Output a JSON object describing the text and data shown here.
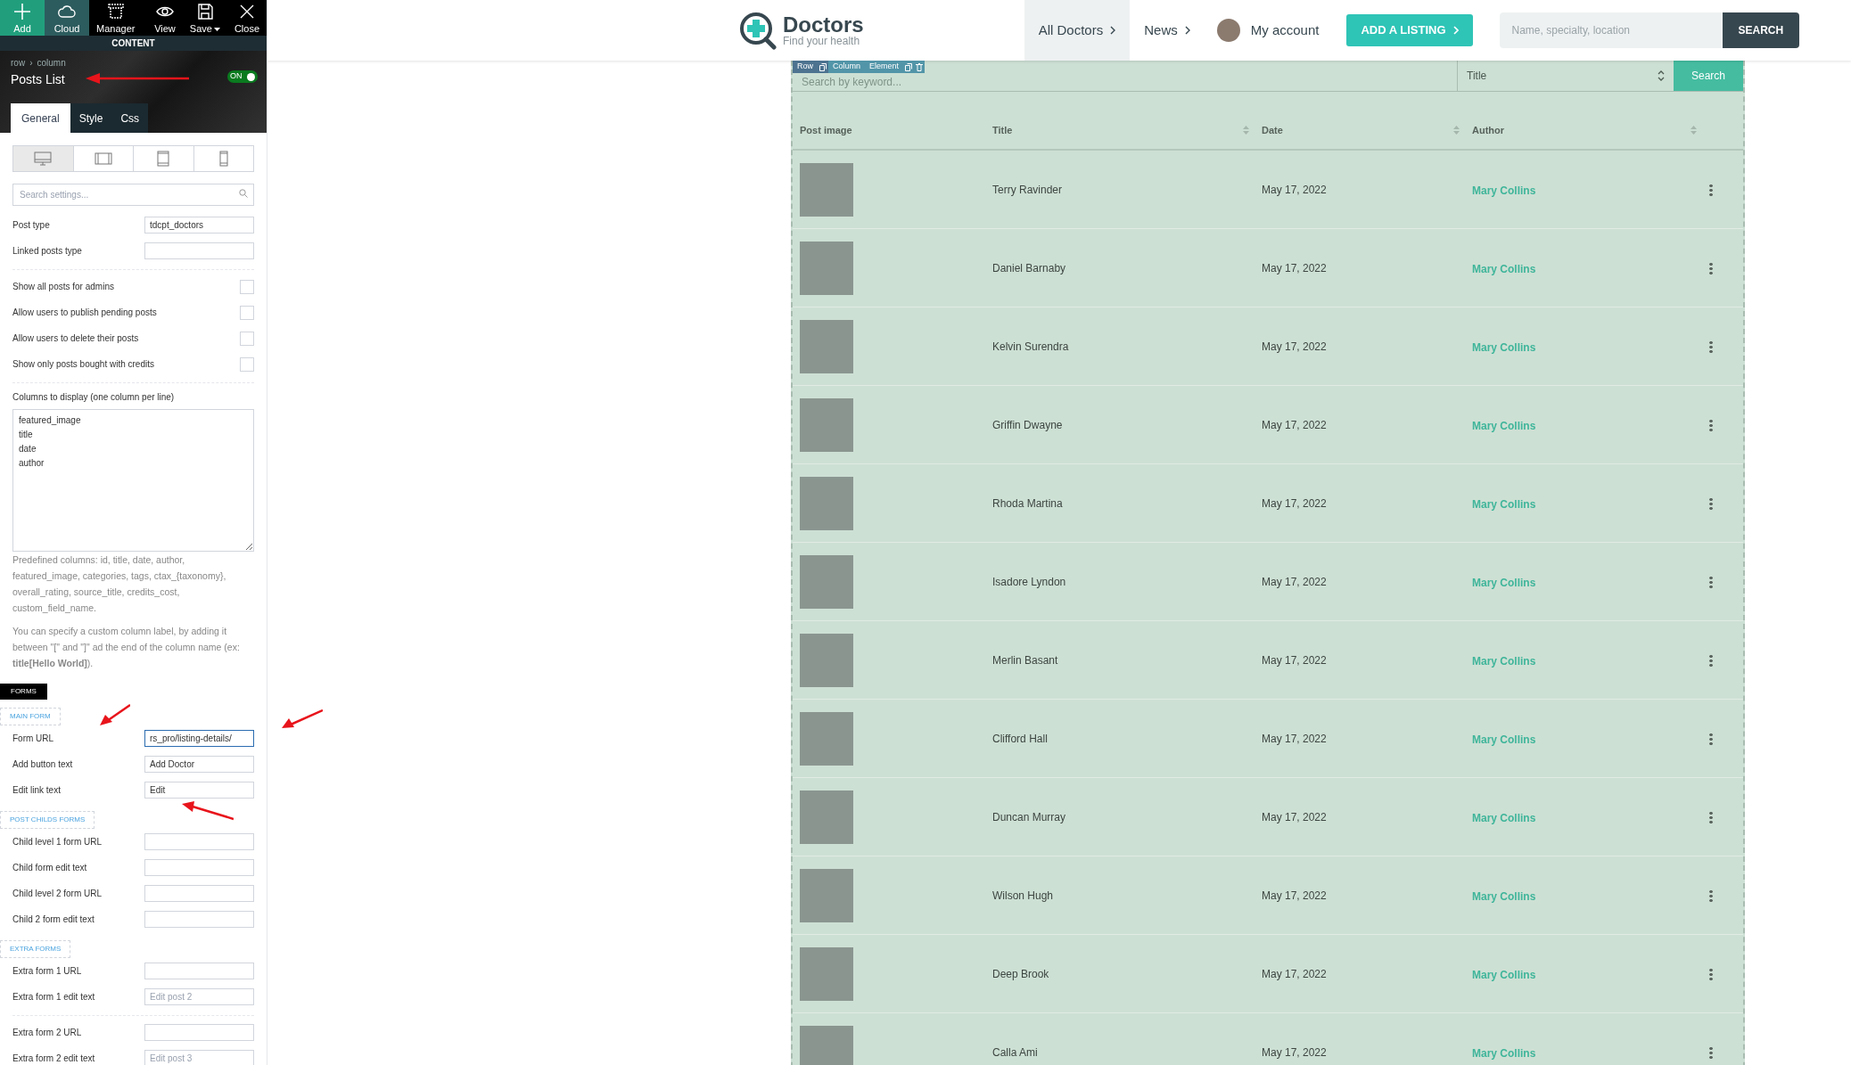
{
  "toolbar": {
    "buttons": [
      {
        "label": "Add",
        "kind": "add"
      },
      {
        "label": "Cloud",
        "kind": "cloud"
      },
      {
        "label": "Manager",
        "kind": "manager"
      },
      {
        "label": "View",
        "kind": "view"
      },
      {
        "label": "Save",
        "kind": "save"
      },
      {
        "label": "Close",
        "kind": "close"
      }
    ],
    "section": "CONTENT"
  },
  "element_panel": {
    "breadcrumb": [
      "row",
      "column"
    ],
    "breadcrumb_separator": "›",
    "title": "Posts List",
    "toggle": {
      "label": "ON",
      "on": true
    },
    "tabs": [
      {
        "label": "General",
        "selected": true
      },
      {
        "label": "Style",
        "selected": false
      },
      {
        "label": "Css",
        "selected": false
      }
    ],
    "devices": [
      {
        "kind": "desktop",
        "selected": true
      },
      {
        "kind": "landscape",
        "selected": false
      },
      {
        "kind": "tablet",
        "selected": false
      },
      {
        "kind": "phone",
        "selected": false
      }
    ],
    "search": {
      "placeholder": "Search settings..."
    },
    "settings": [
      {
        "kind": "input",
        "label": "Post type",
        "value": "tdcpt_doctors"
      },
      {
        "kind": "input",
        "label": "Linked posts type"
      },
      {
        "kind": "divider"
      },
      {
        "kind": "checkbox",
        "label": "Show all posts for admins",
        "checked": false
      },
      {
        "kind": "checkbox",
        "label": "Allow users to publish pending posts",
        "checked": false
      },
      {
        "kind": "checkbox",
        "label": "Allow users to delete their posts",
        "checked": false
      },
      {
        "kind": "checkbox",
        "label": "Show only posts bought with credits",
        "checked": false
      },
      {
        "kind": "divider"
      },
      {
        "kind": "textarea",
        "label": "Columns to display (one column per line)",
        "lines": [
          "featured_image",
          "title",
          "date",
          "author"
        ]
      },
      {
        "kind": "note",
        "text": "Predefined columns: id, title, date, author, featured_image, categories, tags, ctax_{taxonomy}, overall_rating, source_title, credits_cost, custom_field_name."
      },
      {
        "kind": "note",
        "text": "You can specify a custom column label, by adding it between \"[\" and \"]\" ad the end of the column name (ex: **title[Hello World]**)."
      },
      {
        "kind": "badge",
        "text": "FORMS"
      },
      {
        "kind": "group",
        "text": "MAIN FORM"
      },
      {
        "kind": "input",
        "label": "Form URL",
        "value": "rs_pro/listing-details/",
        "focused": true
      },
      {
        "kind": "input",
        "label": "Add button text",
        "value": "Add Doctor"
      },
      {
        "kind": "input",
        "label": "Edit link text",
        "value": "Edit"
      },
      {
        "kind": "group",
        "text": "POST CHILDS FORMS"
      },
      {
        "kind": "input",
        "label": "Child level 1 form URL"
      },
      {
        "kind": "input",
        "label": "Child form edit text"
      },
      {
        "kind": "input",
        "label": "Child level 2 form URL"
      },
      {
        "kind": "input",
        "label": "Child 2 form edit text"
      },
      {
        "kind": "group",
        "text": "EXTRA FORMS"
      },
      {
        "kind": "input",
        "label": "Extra form 1 URL"
      },
      {
        "kind": "input",
        "label": "Extra form 1 edit text",
        "placeholder": "Edit post 2"
      },
      {
        "kind": "divider"
      },
      {
        "kind": "input",
        "label": "Extra form 2 URL"
      },
      {
        "kind": "input",
        "label": "Extra form 2 edit text",
        "placeholder": "Edit post 3"
      }
    ]
  },
  "site_header": {
    "logo": {
      "name": "Doctors",
      "tagline": "Find your health"
    },
    "nav": [
      {
        "label": "All Doctors",
        "selected": true
      },
      {
        "label": "News",
        "selected": false
      }
    ],
    "account": "My account",
    "add_listing": "ADD A LISTING",
    "search": {
      "placeholder": "Name, specialty, location",
      "button": "SEARCH"
    }
  },
  "editor_bar": [
    "Row",
    "Column",
    "Element"
  ],
  "posts_table": {
    "search": {
      "placeholder": "Search by keyword...",
      "sort_by": "Title",
      "button": "Search"
    },
    "columns": [
      {
        "label": "Post image",
        "sortable": false
      },
      {
        "label": "Title",
        "sortable": true
      },
      {
        "label": "Date",
        "sortable": true
      },
      {
        "label": "Author",
        "sortable": true
      }
    ],
    "rows": [
      {
        "title": "Terry Ravinder",
        "date": "May 17, 2022",
        "author": "Mary Collins"
      },
      {
        "title": "Daniel Barnaby",
        "date": "May 17, 2022",
        "author": "Mary Collins"
      },
      {
        "title": "Kelvin Surendra",
        "date": "May 17, 2022",
        "author": "Mary Collins"
      },
      {
        "title": "Griffin Dwayne",
        "date": "May 17, 2022",
        "author": "Mary Collins"
      },
      {
        "title": "Rhoda Martina",
        "date": "May 17, 2022",
        "author": "Mary Collins"
      },
      {
        "title": "Isadore Lyndon",
        "date": "May 17, 2022",
        "author": "Mary Collins"
      },
      {
        "title": "Merlin Basant",
        "date": "May 17, 2022",
        "author": "Mary Collins"
      },
      {
        "title": "Clifford Hall",
        "date": "May 17, 2022",
        "author": "Mary Collins"
      },
      {
        "title": "Duncan Murray",
        "date": "May 17, 2022",
        "author": "Mary Collins"
      },
      {
        "title": "Wilson Hugh",
        "date": "May 17, 2022",
        "author": "Mary Collins"
      },
      {
        "title": "Deep Brook",
        "date": "May 17, 2022",
        "author": "Mary Collins"
      },
      {
        "title": "Calla Ami",
        "date": "May 17, 2022",
        "author": "Mary Collins"
      }
    ]
  }
}
